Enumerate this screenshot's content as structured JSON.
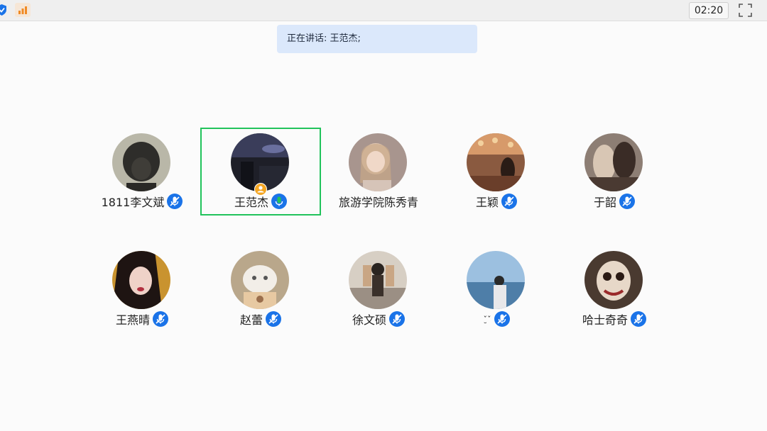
{
  "topbar": {
    "timer": "02:20",
    "icons": [
      "shield-icon",
      "signal-bars-icon",
      "fullscreen-icon"
    ],
    "accent": "#1a73e8"
  },
  "speaking_banner": {
    "text": "正在讲话: 王范杰;"
  },
  "participants": [
    {
      "name": "1811李文斌",
      "mic": "muted",
      "avatar_color": "#3b3a36"
    },
    {
      "name": "王范杰",
      "mic": "speaking",
      "active": true,
      "host": true,
      "avatar_color": "#2c2e3a"
    },
    {
      "name": "旅游学院陈秀青",
      "mic": "muted",
      "avatar_color": "#b89a8e"
    },
    {
      "name": "王颖",
      "mic": "muted",
      "avatar_color": "#8a5a40"
    },
    {
      "name": "于韶",
      "mic": "muted",
      "avatar_color": "#6a5a52"
    },
    {
      "name": "王燕晴",
      "mic": "muted",
      "avatar_color": "#2a1e1e"
    },
    {
      "name": "赵蕾",
      "mic": "muted",
      "avatar_color": "#c9b79b"
    },
    {
      "name": "徐文硕",
      "mic": "muted",
      "avatar_color": "#d7cfc4"
    },
    {
      "name": "ˇ̮ˇ",
      "mic": "muted",
      "avatar_color": "#8fb4d6"
    },
    {
      "name": "哈士奇奇",
      "mic": "muted",
      "avatar_color": "#4a3a30"
    }
  ],
  "colors": {
    "mic_muted": "#1a73e8",
    "mic_speaking": "#21c35b",
    "active_border": "#21c35b",
    "banner_bg": "#dbe8fb"
  }
}
